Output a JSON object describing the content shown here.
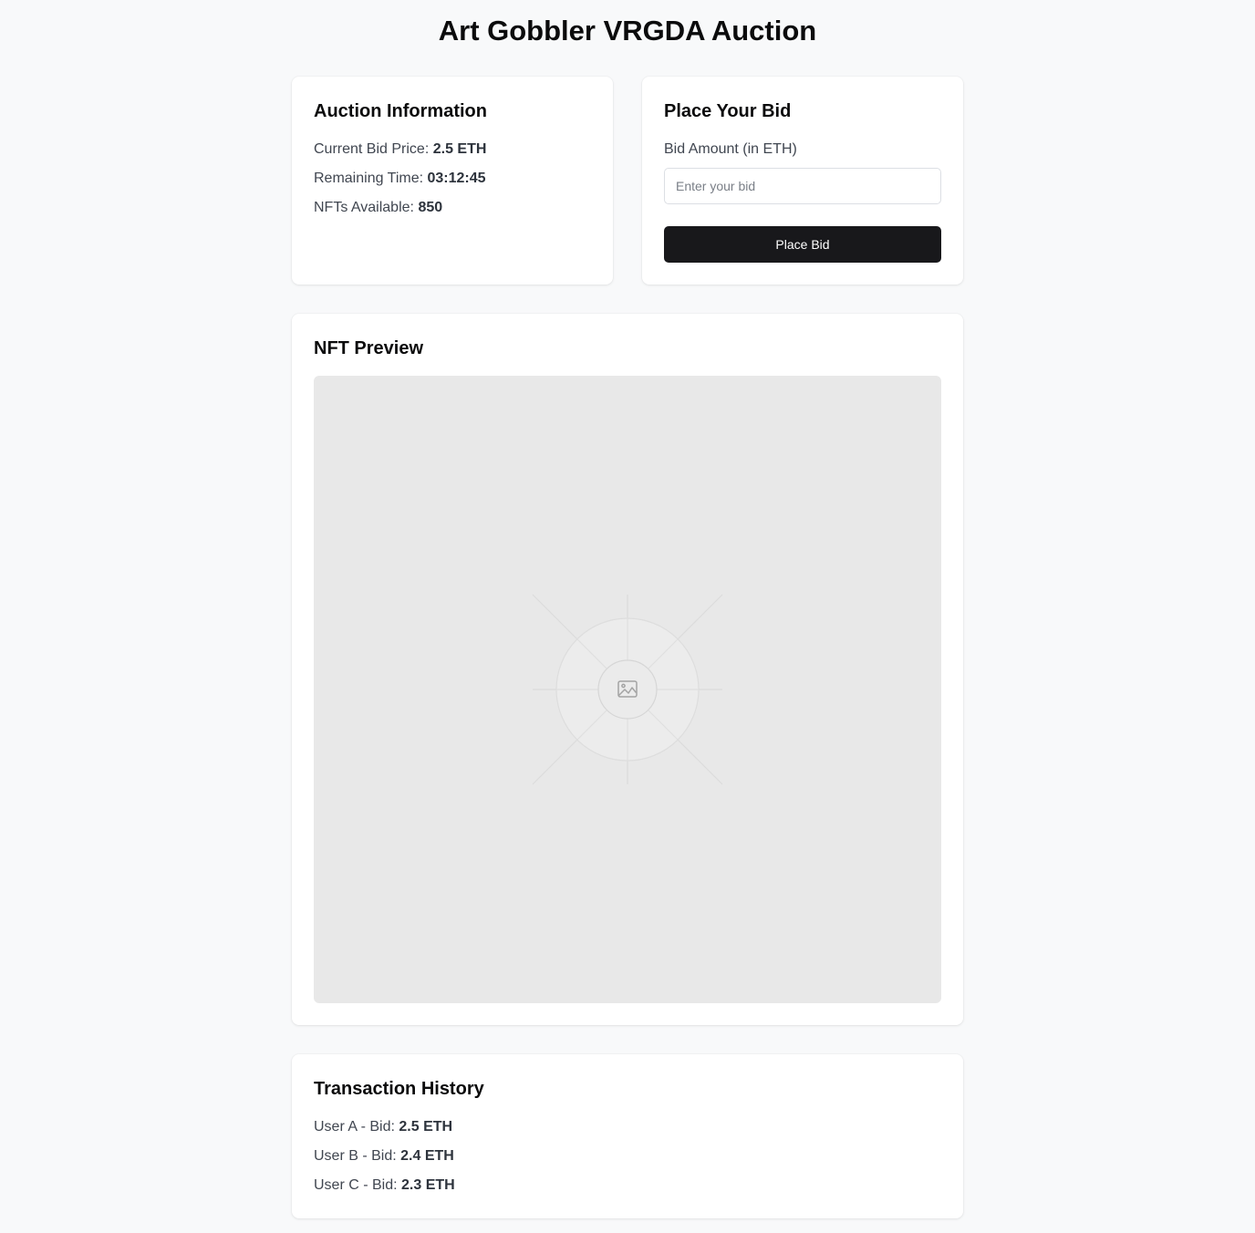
{
  "page": {
    "title": "Art Gobbler VRGDA Auction"
  },
  "auction_info": {
    "heading": "Auction Information",
    "current_bid_label": "Current Bid Price:",
    "current_bid_value": "2.5 ETH",
    "remaining_time_label": "Remaining Time:",
    "remaining_time_value": "03:12:45",
    "nfts_available_label": "NFTs Available:",
    "nfts_available_value": "850"
  },
  "bid_form": {
    "heading": "Place Your Bid",
    "amount_label": "Bid Amount (in ETH)",
    "amount_value": "",
    "amount_placeholder": "Enter your bid",
    "submit_label": "Place Bid"
  },
  "preview": {
    "heading": "NFT Preview",
    "placeholder_icon": "image-icon"
  },
  "history": {
    "heading": "Transaction History",
    "items": [
      {
        "label": "User A - Bid:",
        "value": "2.5 ETH"
      },
      {
        "label": "User B - Bid:",
        "value": "2.4 ETH"
      },
      {
        "label": "User C - Bid:",
        "value": "2.3 ETH"
      }
    ]
  },
  "colors": {
    "page_background": "#f8f9fa",
    "card_background": "#ffffff",
    "button_background": "#18181b",
    "button_text": "#ffffff",
    "preview_background": "#e8e8e8"
  }
}
